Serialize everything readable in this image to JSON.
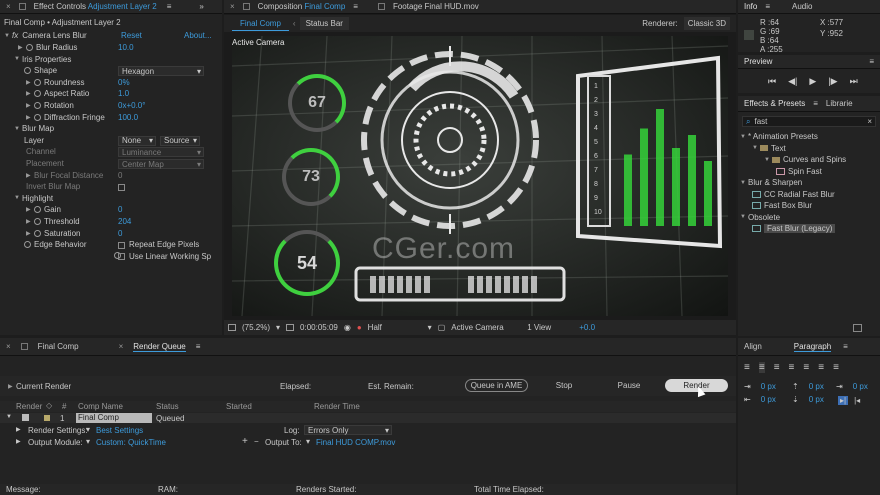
{
  "effect_controls": {
    "tab_title": "Effect Controls",
    "tab_layer": "Adjustment Layer 2",
    "crumb": "Final Comp • Adjustment Layer 2",
    "effect_name": "Camera Lens Blur",
    "reset": "Reset",
    "about": "About...",
    "props": [
      {
        "label": "Blur Radius",
        "value": "10.0"
      },
      {
        "label": "Iris Properties",
        "value": ""
      },
      {
        "label": "Shape",
        "value": "Hexagon"
      },
      {
        "label": "Roundness",
        "value": "0%"
      },
      {
        "label": "Aspect Ratio",
        "value": "1.0"
      },
      {
        "label": "Rotation",
        "value": "0x+0.0°"
      },
      {
        "label": "Diffraction Fringe",
        "value": "100.0"
      },
      {
        "label": "Blur Map",
        "value": ""
      },
      {
        "label": "Layer",
        "value": "None"
      },
      {
        "label": "Channel",
        "value": "Luminance"
      },
      {
        "label": "Placement",
        "value": "Center Map"
      },
      {
        "label": "Blur Focal Distance",
        "value": "0"
      },
      {
        "label": "Invert Blur Map",
        "value": ""
      },
      {
        "label": "Highlight",
        "value": ""
      },
      {
        "label": "Gain",
        "value": "0"
      },
      {
        "label": "Threshold",
        "value": "204"
      },
      {
        "label": "Saturation",
        "value": "0"
      },
      {
        "label": "Edge Behavior",
        "value": "Repeat Edge Pixels"
      },
      {
        "label": "",
        "value": "Use Linear Working Sp"
      }
    ],
    "layer_source": "Source"
  },
  "composition": {
    "tab_prefix": "Composition",
    "tab_name": "Final Comp",
    "footage_tab": "Footage Final HUD.mov",
    "sub_tabs": [
      "Final Comp",
      "Status Bar"
    ],
    "renderer_label": "Renderer:",
    "renderer_value": "Classic 3D",
    "active_camera": "Active Camera",
    "hud_numbers": [
      "67",
      "73",
      "54"
    ],
    "side_numbers": [
      "1",
      "2",
      "3",
      "4",
      "5",
      "6",
      "7",
      "8",
      "9",
      "10"
    ],
    "watermark": "CGer.com",
    "bar_levels": [
      0.55,
      0.75,
      0.9,
      0.6,
      0.7,
      0.5
    ],
    "footer": {
      "zoom": "(75.2%)",
      "timecode": "0:00:05:09",
      "resolution": "Half",
      "view": "Active Camera",
      "views": "1 View",
      "exposure": "+0.0"
    }
  },
  "info": {
    "tab": "Info",
    "tab2": "Audio",
    "r": "64",
    "g": "69",
    "b": "64",
    "a": "255",
    "x": "577",
    "y": "952",
    "swatch": "#404540"
  },
  "preview": {
    "tab": "Preview"
  },
  "effects_presets": {
    "tab": "Effects & Presets",
    "tab2": "Librarie",
    "search": "fast",
    "items": [
      {
        "label": "* Animation Presets",
        "level": 0,
        "kind": "group"
      },
      {
        "label": "Text",
        "level": 1,
        "kind": "folder"
      },
      {
        "label": "Curves and Spins",
        "level": 2,
        "kind": "folder"
      },
      {
        "label": "Spin Fast",
        "level": 3,
        "kind": "preset"
      },
      {
        "label": "Blur & Sharpen",
        "level": 0,
        "kind": "group"
      },
      {
        "label": "CC Radial Fast Blur",
        "level": 1,
        "kind": "fx"
      },
      {
        "label": "Fast Box Blur",
        "level": 1,
        "kind": "fx"
      },
      {
        "label": "Obsolete",
        "level": 0,
        "kind": "group"
      },
      {
        "label": "Fast Blur (Legacy)",
        "level": 1,
        "kind": "fx",
        "selected": true
      }
    ]
  },
  "render_queue": {
    "tabs": [
      "Final Comp",
      "Render Queue"
    ],
    "current_render": "Current Render",
    "elapsed": "Elapsed:",
    "est_remain": "Est. Remain:",
    "queue_in_ame": "Queue in AME",
    "stop": "Stop",
    "pause": "Pause",
    "render": "Render",
    "columns": [
      "Render",
      "#",
      "Comp Name",
      "Status",
      "Started",
      "Render Time"
    ],
    "item": {
      "num": "1",
      "comp": "Final Comp",
      "status": "Queued"
    },
    "render_settings_label": "Render Settings:",
    "render_settings_value": "Best Settings",
    "log_label": "Log:",
    "log_value": "Errors Only",
    "output_module_label": "Output Module:",
    "output_module_value": "Custom: QuickTime",
    "output_to_label": "Output To:",
    "output_to_value": "Final HUD COMP.mov",
    "status_bar": [
      "Message:",
      "RAM:",
      "Renders Started:",
      "Total Time Elapsed:"
    ]
  },
  "align_paragraph": {
    "tabs": [
      "Align",
      "Paragraph"
    ],
    "spacing": [
      "0 px",
      "0 px",
      "0 px",
      "0 px",
      "0 px"
    ]
  }
}
